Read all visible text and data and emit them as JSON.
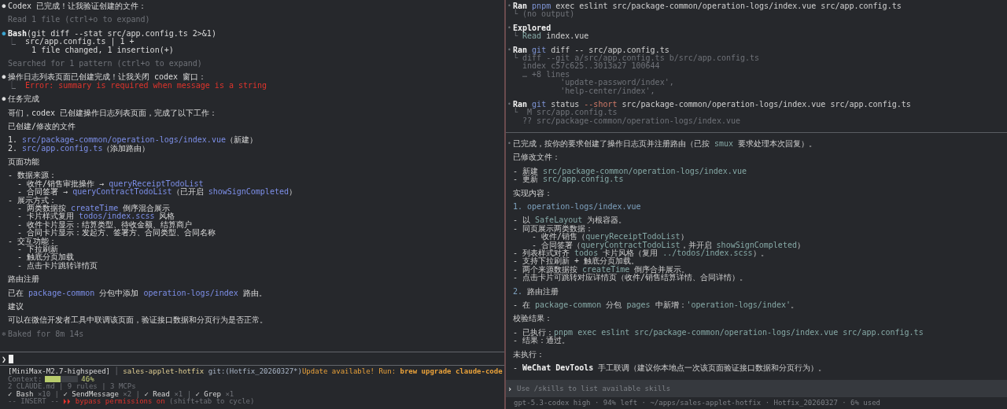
{
  "left_pane": {
    "lines": [
      {
        "kind": "line",
        "bullet": {
          "text": "●",
          "kind": "plain"
        },
        "spans": [
          {
            "kind": "plain",
            "text": "Codex 已完成！让我验证创建的文件："
          }
        ]
      },
      {
        "kind": "blank"
      },
      {
        "kind": "line",
        "spans": [
          {
            "kind": "dim",
            "text": "Read 1 file (ctrl+o to expand)"
          }
        ]
      },
      {
        "kind": "blank"
      },
      {
        "kind": "line",
        "bullet": {
          "text": "●",
          "kind": "blue"
        },
        "spans": [
          {
            "kind": "bold",
            "text": "Bash"
          },
          {
            "kind": "plain",
            "text": "(git diff --stat src/app.config.ts 2>&1)"
          }
        ]
      },
      {
        "kind": "line",
        "spans": [
          {
            "kind": "dim",
            "text": "⎿  "
          },
          {
            "kind": "plain",
            "text": "src/app.config.ts | 1 +"
          }
        ]
      },
      {
        "kind": "line",
        "spans": [
          {
            "kind": "plain",
            "text": "     1 file changed, 1 insertion(+)"
          }
        ]
      },
      {
        "kind": "blank"
      },
      {
        "kind": "line",
        "spans": [
          {
            "kind": "dim",
            "text": "Searched for 1 pattern (ctrl+o to expand)"
          }
        ]
      },
      {
        "kind": "blank"
      },
      {
        "kind": "line",
        "bullet": {
          "text": "●",
          "kind": "plain"
        },
        "spans": [
          {
            "kind": "plain",
            "text": "操作日志列表页面已创建完成！让我关闭 codex 窗口："
          }
        ]
      },
      {
        "kind": "line",
        "spans": [
          {
            "kind": "dim",
            "text": "⎿  "
          },
          {
            "kind": "error",
            "text": "Error: summary is required when message is a string"
          }
        ]
      },
      {
        "kind": "blank"
      },
      {
        "kind": "line",
        "bullet": {
          "text": "●",
          "kind": "plain"
        },
        "spans": [
          {
            "kind": "plain",
            "text": "任务完成"
          }
        ]
      },
      {
        "kind": "blank"
      },
      {
        "kind": "line",
        "spans": [
          {
            "kind": "plain",
            "text": "哥们，codex 已创建操作日志列表页面，完成了以下工作："
          }
        ]
      },
      {
        "kind": "blank"
      },
      {
        "kind": "line",
        "spans": [
          {
            "kind": "plain",
            "text": "已创建/修改的文件"
          }
        ]
      },
      {
        "kind": "blank"
      },
      {
        "kind": "line",
        "spans": [
          {
            "kind": "plain",
            "text": "1. "
          },
          {
            "kind": "link",
            "text": "src/package-common/operation-logs/index.vue"
          },
          {
            "kind": "plain",
            "text": "（新建）"
          }
        ]
      },
      {
        "kind": "line",
        "spans": [
          {
            "kind": "plain",
            "text": "2. "
          },
          {
            "kind": "link",
            "text": "src/app.config.ts"
          },
          {
            "kind": "plain",
            "text": "（添加路由）"
          }
        ]
      },
      {
        "kind": "blank"
      },
      {
        "kind": "line",
        "spans": [
          {
            "kind": "plain",
            "text": "页面功能"
          }
        ]
      },
      {
        "kind": "blank"
      },
      {
        "kind": "line",
        "spans": [
          {
            "kind": "plain",
            "text": "- 数据来源："
          }
        ]
      },
      {
        "kind": "line",
        "spans": [
          {
            "kind": "plain",
            "text": "  - 收件/销售审批操作 → "
          },
          {
            "kind": "link",
            "text": "queryReceiptTodoList"
          }
        ]
      },
      {
        "kind": "line",
        "spans": [
          {
            "kind": "plain",
            "text": "  - 合同签署 → "
          },
          {
            "kind": "link",
            "text": "queryContractTodoList"
          },
          {
            "kind": "plain",
            "text": "（已开启 "
          },
          {
            "kind": "link",
            "text": "showSignCompleted"
          },
          {
            "kind": "plain",
            "text": "）"
          }
        ]
      },
      {
        "kind": "line",
        "spans": [
          {
            "kind": "plain",
            "text": "- 展示方式："
          }
        ]
      },
      {
        "kind": "line",
        "spans": [
          {
            "kind": "plain",
            "text": "  - 两类数据按 "
          },
          {
            "kind": "link",
            "text": "createTime"
          },
          {
            "kind": "plain",
            "text": " 倒序混合展示"
          }
        ]
      },
      {
        "kind": "line",
        "spans": [
          {
            "kind": "plain",
            "text": "  - 卡片样式复用 "
          },
          {
            "kind": "link",
            "text": "todos/index.scss"
          },
          {
            "kind": "plain",
            "text": " 风格"
          }
        ]
      },
      {
        "kind": "line",
        "spans": [
          {
            "kind": "plain",
            "text": "  - 收件卡片显示：结算类型、待收金额、结算商户"
          }
        ]
      },
      {
        "kind": "line",
        "spans": [
          {
            "kind": "plain",
            "text": "  - 合同卡片显示：发起方、签署方、合同类型、合同名称"
          }
        ]
      },
      {
        "kind": "line",
        "spans": [
          {
            "kind": "plain",
            "text": "- 交互功能："
          }
        ]
      },
      {
        "kind": "line",
        "spans": [
          {
            "kind": "plain",
            "text": "  - 下拉刷新"
          }
        ]
      },
      {
        "kind": "line",
        "spans": [
          {
            "kind": "plain",
            "text": "  - 触底分页加载"
          }
        ]
      },
      {
        "kind": "line",
        "spans": [
          {
            "kind": "plain",
            "text": "  - 点击卡片跳转详情页"
          }
        ]
      },
      {
        "kind": "blank"
      },
      {
        "kind": "line",
        "spans": [
          {
            "kind": "plain",
            "text": "路由注册"
          }
        ]
      },
      {
        "kind": "blank"
      },
      {
        "kind": "line",
        "spans": [
          {
            "kind": "plain",
            "text": "已在 "
          },
          {
            "kind": "link",
            "text": "package-common"
          },
          {
            "kind": "plain",
            "text": " 分包中添加 "
          },
          {
            "kind": "link",
            "text": "operation-logs/index"
          },
          {
            "kind": "plain",
            "text": " 路由。"
          }
        ]
      },
      {
        "kind": "blank"
      },
      {
        "kind": "line",
        "spans": [
          {
            "kind": "plain",
            "text": "建议"
          }
        ]
      },
      {
        "kind": "blank"
      },
      {
        "kind": "line",
        "spans": [
          {
            "kind": "plain",
            "text": "可以在微信开发者工具中联调该页面，验证接口数据和分页行为是否正常。"
          }
        ]
      },
      {
        "kind": "blank"
      },
      {
        "kind": "line",
        "bullet": {
          "text": "✻",
          "kind": "dim"
        },
        "spans": [
          {
            "kind": "dim",
            "text": "Baked for 8m 14s"
          }
        ]
      }
    ],
    "prompt": {
      "symbol": "❯"
    },
    "status_rows": [
      {
        "kind": "text",
        "spans": [
          {
            "kind": "plain",
            "text": "[MiniMax-M2.7-highspeed]"
          },
          {
            "kind": "dim",
            "text": " │ "
          },
          {
            "kind": "yellow",
            "text": "sales-applet-hotfix"
          },
          {
            "kind": "slate",
            "text": " git:(Hotfix_20260327*)"
          }
        ],
        "right": [
          {
            "kind": "warn",
            "text": "Update available! Run: "
          },
          {
            "kind": "warn_bold",
            "text": "brew upgrade claude-code"
          }
        ]
      },
      {
        "kind": "meter",
        "label": "Context:",
        "level": 0.46,
        "reading": "46%"
      },
      {
        "kind": "text",
        "spans": [
          {
            "kind": "dim",
            "text": "2 CLAUDE.md | 9 rules | 3 MCPs"
          }
        ]
      },
      {
        "kind": "text",
        "spans": [
          {
            "kind": "plain",
            "text": "✓ Bash "
          },
          {
            "kind": "dim",
            "text": "×10"
          },
          {
            "kind": "dim",
            "text": " | "
          },
          {
            "kind": "plain",
            "text": "✓ SendMessage "
          },
          {
            "kind": "dim",
            "text": "×2"
          },
          {
            "kind": "dim",
            "text": " | "
          },
          {
            "kind": "plain",
            "text": "✓ Read "
          },
          {
            "kind": "dim",
            "text": "×1"
          },
          {
            "kind": "dim",
            "text": " | "
          },
          {
            "kind": "plain",
            "text": "✓ Grep "
          },
          {
            "kind": "dim",
            "text": "×1"
          }
        ]
      },
      {
        "kind": "text",
        "spans": [
          {
            "kind": "dim",
            "text": "-- INSERT -- "
          },
          {
            "kind": "error",
            "text": "⏵⏵ bypass permissions on"
          },
          {
            "kind": "dim",
            "text": " (shift+tab to cycle)"
          }
        ]
      }
    ]
  },
  "right_pane": {
    "lines": [
      {
        "kind": "line",
        "bullet": {
          "text": "•",
          "kind": "dim"
        },
        "spans": [
          {
            "kind": "bold",
            "text": "Ran "
          },
          {
            "kind": "cmd",
            "text": "pnpm"
          },
          {
            "kind": "plain",
            "text": " exec eslint src/package-common/operation-logs/index.vue src/app.config.ts"
          }
        ]
      },
      {
        "kind": "line",
        "spans": [
          {
            "kind": "dim",
            "text": "└ (no output)"
          }
        ]
      },
      {
        "kind": "blank"
      },
      {
        "kind": "line",
        "bullet": {
          "text": "•",
          "kind": "dim"
        },
        "spans": [
          {
            "kind": "bold",
            "text": "Explored"
          }
        ]
      },
      {
        "kind": "line",
        "spans": [
          {
            "kind": "dim",
            "text": "└ "
          },
          {
            "kind": "code",
            "text": "Read"
          },
          {
            "kind": "plain",
            "text": " index.vue"
          }
        ]
      },
      {
        "kind": "blank"
      },
      {
        "kind": "line",
        "bullet": {
          "text": "•",
          "kind": "dim"
        },
        "spans": [
          {
            "kind": "bold",
            "text": "Ran "
          },
          {
            "kind": "cmd",
            "text": "git"
          },
          {
            "kind": "plain",
            "text": " diff -- src/app.config.ts"
          }
        ]
      },
      {
        "kind": "line",
        "spans": [
          {
            "kind": "dim",
            "text": "└ diff --git a/src/app.config.ts b/src/app.config.ts"
          }
        ]
      },
      {
        "kind": "line",
        "spans": [
          {
            "kind": "dim",
            "text": "  index c57c625..3013a27 100644"
          }
        ]
      },
      {
        "kind": "line",
        "spans": [
          {
            "kind": "dim",
            "text": "  … +8 lines"
          }
        ]
      },
      {
        "kind": "line",
        "spans": [
          {
            "kind": "dim",
            "text": "          'update-password/index',"
          }
        ]
      },
      {
        "kind": "line",
        "spans": [
          {
            "kind": "dim",
            "text": "          'help-center/index',"
          }
        ]
      },
      {
        "kind": "blank"
      },
      {
        "kind": "line",
        "bullet": {
          "text": "•",
          "kind": "dim"
        },
        "spans": [
          {
            "kind": "bold",
            "text": "Ran "
          },
          {
            "kind": "cmd",
            "text": "git"
          },
          {
            "kind": "plain",
            "text": " status "
          },
          {
            "kind": "flag",
            "text": "--short"
          },
          {
            "kind": "plain",
            "text": " src/package-common/operation-logs/index.vue src/app.config.ts"
          }
        ]
      },
      {
        "kind": "line",
        "spans": [
          {
            "kind": "dim",
            "text": "└  M src/app.config.ts"
          }
        ]
      },
      {
        "kind": "line",
        "spans": [
          {
            "kind": "dim",
            "text": "  ?? src/package-common/operation-logs/index.vue"
          }
        ]
      },
      {
        "kind": "blank"
      },
      {
        "kind": "separator"
      },
      {
        "kind": "blank"
      },
      {
        "kind": "line",
        "bullet": {
          "text": "•",
          "kind": "dim"
        },
        "spans": [
          {
            "kind": "plain",
            "text": "已完成，按你的要求创建了操作日志页并注册路由（已按 "
          },
          {
            "kind": "code",
            "text": "smux"
          },
          {
            "kind": "plain",
            "text": " 要求处理本次回复）。"
          }
        ]
      },
      {
        "kind": "blank"
      },
      {
        "kind": "line",
        "spans": [
          {
            "kind": "plain",
            "text": "已修改文件："
          }
        ]
      },
      {
        "kind": "blank"
      },
      {
        "kind": "line",
        "spans": [
          {
            "kind": "plain",
            "text": "- 新建 "
          },
          {
            "kind": "code",
            "text": "src/package-common/operation-logs/index.vue"
          }
        ]
      },
      {
        "kind": "line",
        "spans": [
          {
            "kind": "plain",
            "text": "- 更新 "
          },
          {
            "kind": "code",
            "text": "src/app.config.ts"
          }
        ]
      },
      {
        "kind": "blank"
      },
      {
        "kind": "line",
        "spans": [
          {
            "kind": "plain",
            "text": "实现内容："
          }
        ]
      },
      {
        "kind": "blank"
      },
      {
        "kind": "line",
        "spans": [
          {
            "kind": "heading",
            "text": "1. operation-logs/index.vue"
          }
        ]
      },
      {
        "kind": "blank"
      },
      {
        "kind": "line",
        "spans": [
          {
            "kind": "plain",
            "text": "- 以 "
          },
          {
            "kind": "code",
            "text": "SafeLayout"
          },
          {
            "kind": "plain",
            "text": " 为根容器。"
          }
        ]
      },
      {
        "kind": "line",
        "spans": [
          {
            "kind": "plain",
            "text": "- 同页展示两类数据："
          }
        ]
      },
      {
        "kind": "line",
        "spans": [
          {
            "kind": "plain",
            "text": "    - 收件/销售（"
          },
          {
            "kind": "code",
            "text": "queryReceiptTodoList"
          },
          {
            "kind": "plain",
            "text": "）"
          }
        ]
      },
      {
        "kind": "line",
        "spans": [
          {
            "kind": "plain",
            "text": "    - 合同签署（"
          },
          {
            "kind": "code",
            "text": "queryContractTodoList"
          },
          {
            "kind": "plain",
            "text": "，并开启 "
          },
          {
            "kind": "code",
            "text": "showSignCompleted"
          },
          {
            "kind": "plain",
            "text": "）"
          }
        ]
      },
      {
        "kind": "line",
        "spans": [
          {
            "kind": "plain",
            "text": "- 列表样式对齐 "
          },
          {
            "kind": "code",
            "text": "todos"
          },
          {
            "kind": "plain",
            "text": " 卡片风格（复用 "
          },
          {
            "kind": "code",
            "text": "../todos/index.scss"
          },
          {
            "kind": "plain",
            "text": "）。"
          }
        ]
      },
      {
        "kind": "line",
        "spans": [
          {
            "kind": "plain",
            "text": "- 支持下拉刷新 + 触底分页加载。"
          }
        ]
      },
      {
        "kind": "line",
        "spans": [
          {
            "kind": "plain",
            "text": "- 两个来源数据按 "
          },
          {
            "kind": "code",
            "text": "createTime"
          },
          {
            "kind": "plain",
            "text": " 倒序合并展示。"
          }
        ]
      },
      {
        "kind": "line",
        "spans": [
          {
            "kind": "plain",
            "text": "- 点击卡片可跳转对应详情页（收件/销售结算详情、合同详情）。"
          }
        ]
      },
      {
        "kind": "blank"
      },
      {
        "kind": "line",
        "spans": [
          {
            "kind": "heading",
            "text": "2. "
          },
          {
            "kind": "plain",
            "text": "路由注册"
          }
        ]
      },
      {
        "kind": "blank"
      },
      {
        "kind": "line",
        "spans": [
          {
            "kind": "plain",
            "text": "- 在 "
          },
          {
            "kind": "code",
            "text": "package-common"
          },
          {
            "kind": "plain",
            "text": " 分包 "
          },
          {
            "kind": "code",
            "text": "pages"
          },
          {
            "kind": "plain",
            "text": " 中新增："
          },
          {
            "kind": "code",
            "text": "'operation-logs/index'"
          },
          {
            "kind": "plain",
            "text": "。"
          }
        ]
      },
      {
        "kind": "blank"
      },
      {
        "kind": "line",
        "spans": [
          {
            "kind": "plain",
            "text": "校验结果："
          }
        ]
      },
      {
        "kind": "blank"
      },
      {
        "kind": "line",
        "spans": [
          {
            "kind": "plain",
            "text": "- 已执行："
          },
          {
            "kind": "code",
            "text": "pnpm exec eslint src/package-common/operation-logs/index.vue src/app.config.ts"
          }
        ]
      },
      {
        "kind": "line",
        "spans": [
          {
            "kind": "plain",
            "text": "- 结果：通过。"
          }
        ]
      },
      {
        "kind": "blank"
      },
      {
        "kind": "line",
        "spans": [
          {
            "kind": "plain",
            "text": "未执行："
          }
        ]
      },
      {
        "kind": "blank"
      },
      {
        "kind": "line",
        "spans": [
          {
            "kind": "plain",
            "text": "- "
          },
          {
            "kind": "bold",
            "text": "WeChat DevTools"
          },
          {
            "kind": "plain",
            "text": " 手工联调（建议你本地点一次该页面验证接口数据和分页行为）。"
          }
        ]
      }
    ],
    "composer": {
      "symbol": "›",
      "placeholder": "Use /skills to list available skills"
    },
    "status": "gpt-5.3-codex high · 94% left · ~/apps/sales-applet-hotfix · Hotfix_20260327 · 6% used"
  }
}
